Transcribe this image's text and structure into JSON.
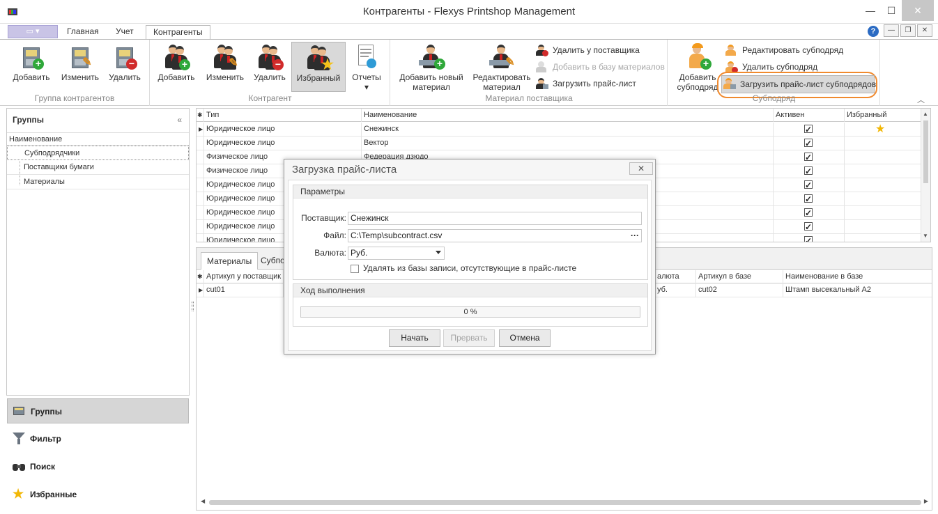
{
  "window": {
    "title": "Контрагенты - Flexys Printshop Management"
  },
  "ribbon_tabs": [
    "Главная",
    "Учет",
    "Контрагенты"
  ],
  "ribbon": {
    "groups": {
      "contractor_group": {
        "caption": "Группа контрагентов",
        "add": "Добавить",
        "edit": "Изменить",
        "delete": "Удалить"
      },
      "contractor": {
        "caption": "Контрагент",
        "add": "Добавить",
        "edit": "Изменить",
        "delete": "Удалить",
        "favorite": "Избранный",
        "reports": "Отчеты"
      },
      "supplier_material": {
        "caption": "Материал поставщика",
        "add_new": [
          "Добавить новый",
          "материал"
        ],
        "edit": [
          "Редактировать",
          "материал"
        ],
        "remove_from_supplier": "Удалить у поставщика",
        "add_to_db": "Добавить в базу материалов",
        "load_pricelist": "Загрузить прайс-лист"
      },
      "subcontract": {
        "caption": "Субподряд",
        "add": [
          "Добавить",
          "субподряд"
        ],
        "edit": "Редактировать субподряд",
        "delete": "Удалить субподряд",
        "load_pricelist": "Загрузить прайс-лист субподрядов"
      }
    }
  },
  "left_pane": {
    "header": "Группы",
    "column": "Наименование",
    "items": [
      "Субподрядчики",
      "Поставщики бумаги",
      "Материалы"
    ]
  },
  "nav": {
    "groups": "Группы",
    "filter": "Фильтр",
    "search": "Поиск",
    "favorites": "Избранные"
  },
  "grid": {
    "columns": [
      "Тип",
      "Наименование",
      "Активен",
      "Избранный"
    ],
    "rows": [
      {
        "type": "Юридическое лицо",
        "name": "Снежинск",
        "active": true,
        "favorite": true
      },
      {
        "type": "Юридическое лицо",
        "name": "Вектор",
        "active": true,
        "favorite": false
      },
      {
        "type": "Физическое лицо",
        "name": "Федерация дзюдо",
        "active": true,
        "favorite": false
      },
      {
        "type": "Физическое лицо",
        "name": "",
        "active": true,
        "favorite": false
      },
      {
        "type": "Юридическое лицо",
        "name": "",
        "active": true,
        "favorite": false
      },
      {
        "type": "Юридическое лицо",
        "name": "",
        "active": true,
        "favorite": false
      },
      {
        "type": "Юридическое лицо",
        "name": "",
        "active": true,
        "favorite": false
      },
      {
        "type": "Юридическое лицо",
        "name": "",
        "active": true,
        "favorite": false
      },
      {
        "type": "Юридическое лицо",
        "name": "",
        "active": true,
        "favorite": false
      }
    ]
  },
  "bottom": {
    "tabs": [
      "Материалы",
      "Субпод"
    ],
    "columns": [
      "Артикул у поставщик",
      "алюта",
      "Артикул в базе",
      "Наименование в базе"
    ],
    "rows": [
      {
        "supplier_sku": "cut01",
        "currency": "уб.",
        "db_sku": "cut02",
        "db_name": "Штамп высекальный А2"
      }
    ]
  },
  "dialog": {
    "title": "Загрузка прайс-листа",
    "params_legend": "Параметры",
    "supplier_label": "Поставщик:",
    "supplier_value": "Снежинск",
    "file_label": "Файл:",
    "file_value": "C:\\Temp\\subcontract.csv",
    "file_button": "···",
    "currency_label": "Валюта:",
    "currency_value": "Руб.",
    "remove_missing_label": "Удалять из базы записи, отсутствующие в прайс-листе",
    "remove_missing_checked": false,
    "progress_legend": "Ход выполнения",
    "progress_percent": 0,
    "progress_text": "0 %",
    "start": "Начать",
    "abort": "Прервать",
    "cancel": "Отмена"
  },
  "colors": {
    "highlight_ring": "#f08a2e",
    "favorite_star": "#f2b705",
    "add_badge": "#2fa83a",
    "delete_badge": "#d12b2b"
  }
}
